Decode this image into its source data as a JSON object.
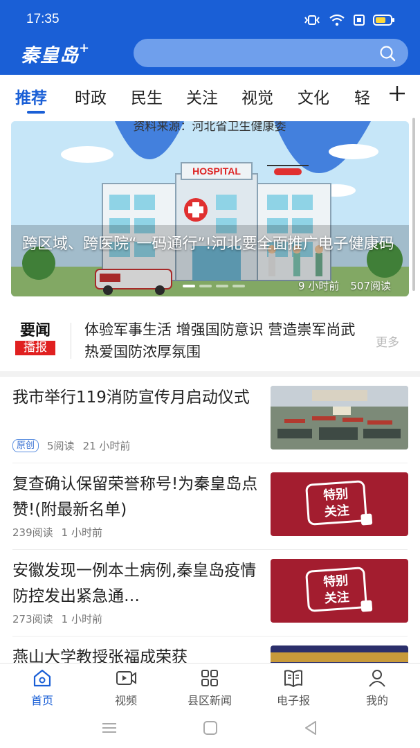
{
  "status_bar": {
    "time": "17:35"
  },
  "header": {
    "logo_text": "秦皇岛",
    "logo_plus": "+",
    "search_placeholder": ""
  },
  "tabs": [
    {
      "label": "推荐",
      "active": true
    },
    {
      "label": "时政"
    },
    {
      "label": "民生"
    },
    {
      "label": "关注"
    },
    {
      "label": "视觉"
    },
    {
      "label": "文化"
    },
    {
      "label": "轻"
    }
  ],
  "banner": {
    "image_caption_top": "资料来源：河北省卫生健康委",
    "hospital_sign": "HOSPITAL",
    "title": "跨区域、跨医院“一码通行”!河北要全面推广电子健康码",
    "time_ago": "9 小时前",
    "reads": "507阅读"
  },
  "brief": {
    "logo_top": "要闻",
    "logo_bottom": "播报",
    "text": "体验军事生活 增强国防意识 营造崇军尚武热爱国防浓厚氛围",
    "more": "更多"
  },
  "news": [
    {
      "title": "我市举行119消防宣传月启动仪式",
      "badge": "原创",
      "reads": "5阅读",
      "time": "21 小时前",
      "thumb": "photo"
    },
    {
      "title": "复查确认保留荣誉称号!为秦皇岛点赞!(附最新名单)",
      "reads": "239阅读",
      "time": "1 小时前",
      "thumb": "special",
      "thumb_text_1": "特别",
      "thumb_text_2": "关注"
    },
    {
      "title": "安徽发现一例本土病例,秦皇岛疫情防控发出紧急通…",
      "reads": "273阅读",
      "time": "1 小时前",
      "thumb": "special",
      "thumb_text_1": "特别",
      "thumb_text_2": "关注"
    },
    {
      "title": "燕山大学教授张福成荣获",
      "thumb": "photo"
    }
  ],
  "bottom_nav": [
    {
      "label": "首页",
      "icon": "home-icon",
      "active": true
    },
    {
      "label": "视频",
      "icon": "video-icon"
    },
    {
      "label": "县区新闻",
      "icon": "grid-icon"
    },
    {
      "label": "电子报",
      "icon": "newspaper-icon"
    },
    {
      "label": "我的",
      "icon": "user-icon"
    }
  ],
  "colors": {
    "brand": "#1a5fd6",
    "special": "#a31d2f"
  }
}
